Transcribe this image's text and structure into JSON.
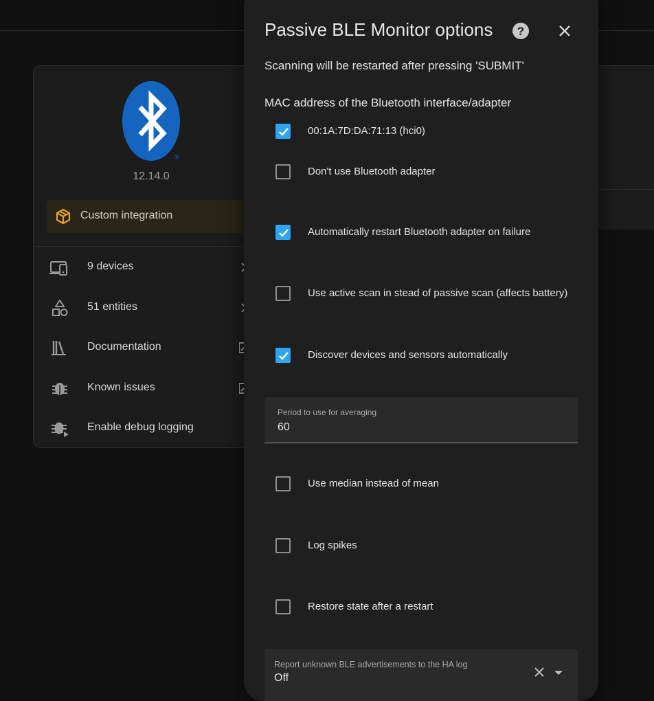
{
  "integration": {
    "version": "12.14.0",
    "custom_label": "Custom integration",
    "brand_color": "#1565c0",
    "accent_color": "#e3a12f",
    "menu": [
      {
        "icon": "devices-icon",
        "label": "9 devices"
      },
      {
        "icon": "entities-icon",
        "label": "51 entities"
      },
      {
        "icon": "book-icon",
        "label": "Documentation"
      },
      {
        "icon": "bug-icon",
        "label": "Known issues"
      },
      {
        "icon": "bug-play-icon",
        "label": "Enable debug logging"
      }
    ]
  },
  "dialog": {
    "title": "Passive BLE Monitor options",
    "description": "Scanning will be restarted after pressing 'SUBMIT'",
    "mac_section_label": "MAC address of the Bluetooth interface/adapter",
    "adapters": [
      {
        "label": "00:1A:7D:DA:71:13 (hci0)",
        "checked": true
      },
      {
        "label": "Don't use Bluetooth adapter",
        "checked": false
      }
    ],
    "options": [
      {
        "label": "Automatically restart Bluetooth adapter on failure",
        "checked": true
      },
      {
        "label": "Use active scan in stead of passive scan (affects battery)",
        "checked": false
      },
      {
        "label": "Discover devices and sensors automatically",
        "checked": true
      }
    ],
    "period_field": {
      "label": "Period to use for averaging",
      "value": "60"
    },
    "options2": [
      {
        "label": "Use median instead of mean",
        "checked": false
      },
      {
        "label": "Log spikes",
        "checked": false
      },
      {
        "label": "Restore state after a restart",
        "checked": false
      }
    ],
    "report_select": {
      "label": "Report unknown BLE advertisements to the HA log",
      "value": "Off"
    },
    "checkbox_color": "#2ea4f2"
  }
}
